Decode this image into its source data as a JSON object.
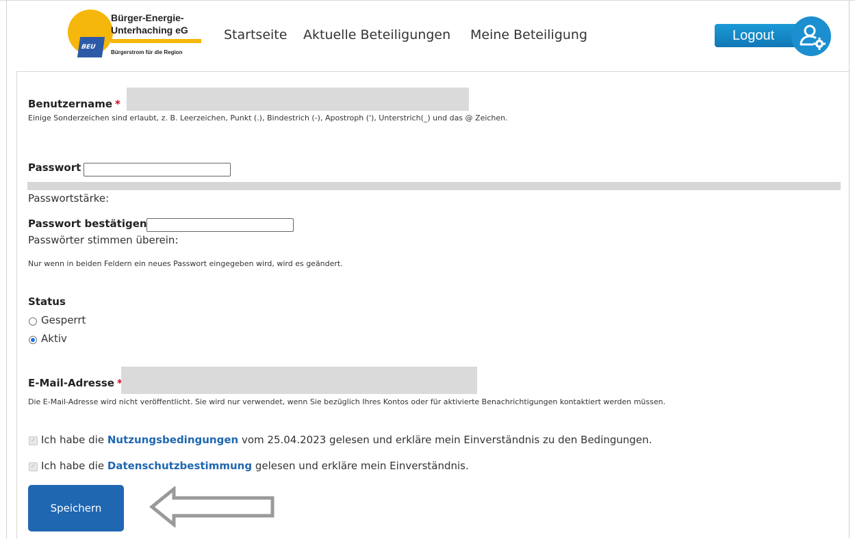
{
  "header": {
    "logo": {
      "line1": "Bürger-Energie-",
      "line2": "Unterhaching eG",
      "tagline": "Bürgerstrom für die Region",
      "abbrev": "BEU"
    },
    "nav": [
      "Startseite",
      "Aktuelle Beteiligungen",
      "Meine Beteiligung"
    ],
    "logout_label": "Logout"
  },
  "form": {
    "username": {
      "label": "Benutzername",
      "required_marker": "*",
      "help": "Einige Sonderzeichen sind erlaubt, z. B. Leerzeichen, Punkt (.), Bindestrich (-), Apostroph ('), Unterstrich(_) und das @ Zeichen."
    },
    "password": {
      "label": "Passwort",
      "strength_label": "Passwortstärke:"
    },
    "password_confirm": {
      "label": "Passwort bestätigen",
      "match_label": "Passwörter stimmen überein:",
      "help": "Nur wenn in beiden Feldern ein neues Passwort eingegeben wird, wird es geändert."
    },
    "status": {
      "label": "Status",
      "options": [
        "Gesperrt",
        "Aktiv"
      ],
      "selected": "Aktiv"
    },
    "email": {
      "label": "E-Mail-Adresse",
      "required_marker": "*",
      "help": "Die E-Mail-Adresse wird nicht veröffentlicht. Sie wird nur verwendet, wenn Sie bezüglich Ihres Kontos oder für aktivierte Benachrichtigungen kontaktiert werden müssen."
    },
    "terms": {
      "prefix": "Ich habe die",
      "link": "Nutzungsbedingungen",
      "suffix": "vom 25.04.2023 gelesen und erkläre mein Einverständnis zu den Bedingungen.",
      "checked": true
    },
    "privacy": {
      "prefix": "Ich habe die",
      "link": "Datenschutzbestimmung",
      "suffix": "gelesen und erkläre mein Einverständnis.",
      "checked": true
    },
    "save_label": "Speichern"
  },
  "colors": {
    "accent": "#1f67b1",
    "logo_yellow": "#f5b70b",
    "logo_blue": "#2d5aa8",
    "required": "#d0021b"
  }
}
